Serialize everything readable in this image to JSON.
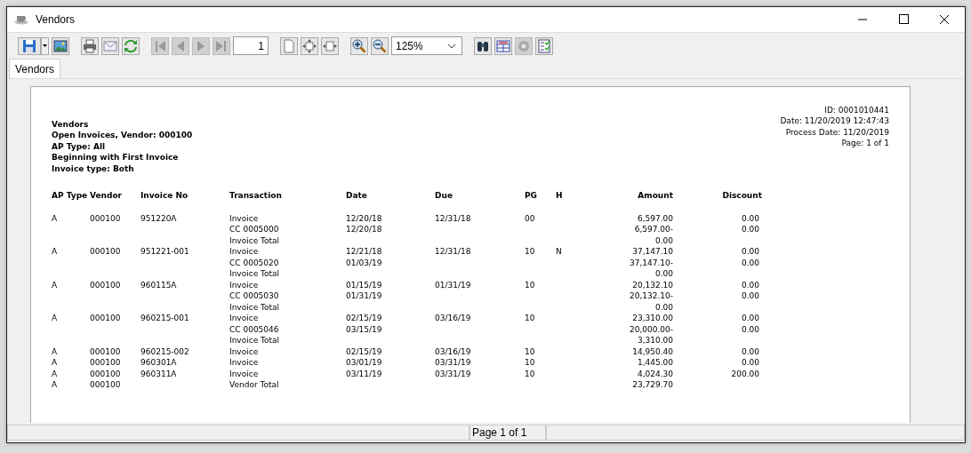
{
  "window": {
    "title": "Vendors"
  },
  "toolbar": [
    {
      "kind": "save",
      "disabled": false
    },
    {
      "kind": "dropdown",
      "disabled": false
    },
    {
      "kind": "image",
      "disabled": false
    },
    {
      "kind": "sep"
    },
    {
      "kind": "print",
      "disabled": false
    },
    {
      "kind": "email",
      "disabled": false
    },
    {
      "kind": "refresh",
      "disabled": false
    },
    {
      "kind": "sep"
    },
    {
      "kind": "first",
      "disabled": true
    },
    {
      "kind": "prev",
      "disabled": true
    },
    {
      "kind": "next",
      "disabled": true
    },
    {
      "kind": "last",
      "disabled": true
    },
    {
      "kind": "page",
      "value": "1"
    },
    {
      "kind": "sep"
    },
    {
      "kind": "single",
      "disabled": false
    },
    {
      "kind": "fitpage",
      "disabled": false
    },
    {
      "kind": "fitwidth",
      "disabled": false
    },
    {
      "kind": "sep"
    },
    {
      "kind": "zoomin",
      "disabled": false
    },
    {
      "kind": "zoomout",
      "disabled": false
    },
    {
      "kind": "zoom",
      "value": "125%"
    },
    {
      "kind": "sep"
    },
    {
      "kind": "find",
      "disabled": false
    },
    {
      "kind": "columns",
      "disabled": false
    },
    {
      "kind": "settings",
      "disabled": true
    },
    {
      "kind": "checklist",
      "disabled": false
    }
  ],
  "tabs": [
    {
      "label": "Vendors",
      "selected": true
    }
  ],
  "report": {
    "title_lines": [
      "Vendors",
      "Open Invoices, Vendor: 000100",
      "AP Type: All",
      "Beginning with First Invoice",
      "Invoice type: Both"
    ],
    "info_lines": [
      "ID: 0001010441",
      "Date: 11/20/2019 12:47:43",
      "Process Date: 11/20/2019",
      "Page: 1 of 1"
    ],
    "columns": [
      "AP Type",
      "Vendor",
      "Invoice No",
      "Transaction",
      "Date",
      "Due",
      "PG",
      "H",
      "Amount",
      "Discount"
    ],
    "rows": [
      [
        "A",
        "000100",
        "951220A",
        "Invoice",
        "12/20/18",
        "12/31/18",
        "00",
        "",
        "6,597.00",
        "0.00"
      ],
      [
        "",
        "",
        "",
        "CC 0005000",
        "12/20/18",
        "",
        "",
        "",
        "6,597.00-",
        "0.00"
      ],
      [
        "",
        "",
        "",
        "Invoice Total",
        "",
        "",
        "",
        "",
        "0.00",
        ""
      ],
      [
        "A",
        "000100",
        "951221-001",
        "Invoice",
        "12/21/18",
        "12/31/18",
        "10",
        "N",
        "37,147.10",
        "0.00"
      ],
      [
        "",
        "",
        "",
        "CC 0005020",
        "01/03/19",
        "",
        "",
        "",
        "37,147.10-",
        "0.00"
      ],
      [
        "",
        "",
        "",
        "Invoice Total",
        "",
        "",
        "",
        "",
        "0.00",
        ""
      ],
      [
        "A",
        "000100",
        "960115A",
        "Invoice",
        "01/15/19",
        "01/31/19",
        "10",
        "",
        "20,132.10",
        "0.00"
      ],
      [
        "",
        "",
        "",
        "CC 0005030",
        "01/31/19",
        "",
        "",
        "",
        "20,132.10-",
        "0.00"
      ],
      [
        "",
        "",
        "",
        "Invoice Total",
        "",
        "",
        "",
        "",
        "0.00",
        ""
      ],
      [
        "A",
        "000100",
        "960215-001",
        "Invoice",
        "02/15/19",
        "03/16/19",
        "10",
        "",
        "23,310.00",
        "0.00"
      ],
      [
        "",
        "",
        "",
        "CC 0005046",
        "03/15/19",
        "",
        "",
        "",
        "20,000.00-",
        "0.00"
      ],
      [
        "",
        "",
        "",
        "Invoice Total",
        "",
        "",
        "",
        "",
        "3,310.00",
        ""
      ],
      [
        "A",
        "000100",
        "960215-002",
        "Invoice",
        "02/15/19",
        "03/16/19",
        "10",
        "",
        "14,950.40",
        "0.00"
      ],
      [
        "A",
        "000100",
        "960301A",
        "Invoice",
        "03/01/19",
        "03/31/19",
        "10",
        "",
        "1,445.00",
        "0.00"
      ],
      [
        "A",
        "000100",
        "960311A",
        "Invoice",
        "03/11/19",
        "03/31/19",
        "10",
        "",
        "4,024.30",
        "200.00"
      ],
      [
        "A",
        "000100",
        "",
        "Vendor Total",
        "",
        "",
        "",
        "",
        "23,729.70",
        ""
      ]
    ]
  },
  "status_bar": {
    "text": "Page 1 of 1"
  }
}
